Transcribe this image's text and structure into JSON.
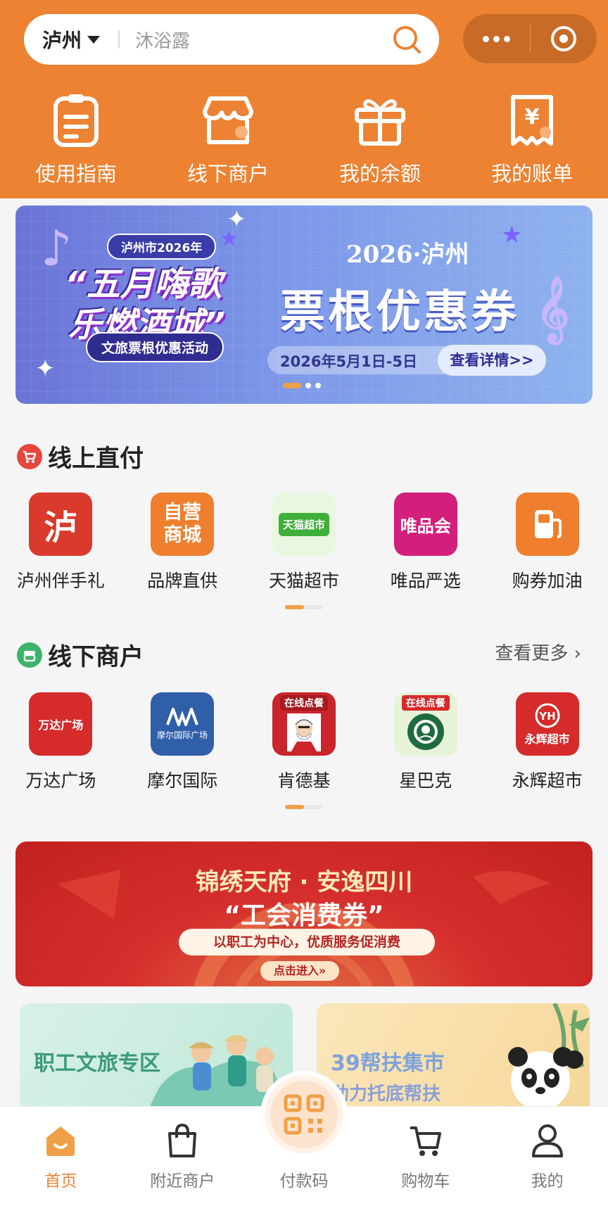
{
  "header": {
    "city": "泸州",
    "search_placeholder": "沐浴露",
    "bg_color": "#ec8232"
  },
  "capsule": {
    "more": "more-icon",
    "close": "target-icon"
  },
  "top_nav": [
    {
      "label": "使用指南",
      "icon": "guide-icon"
    },
    {
      "label": "线下商户",
      "icon": "store-icon"
    },
    {
      "label": "我的余额",
      "icon": "gift-icon"
    },
    {
      "label": "我的账单",
      "icon": "bill-icon"
    }
  ],
  "banner": {
    "tag": "泸州市2026年",
    "headline_1": "“五月嗨歌",
    "headline_2": "乐燃酒城”",
    "subtitle": "文旅票根优惠活动",
    "year_city": "2026·泸州",
    "main_title": "票根优惠券",
    "date_range": "2026年5月1日-5日",
    "cta": "查看详情>>"
  },
  "online_section": {
    "title": "线上直付",
    "apps": [
      {
        "name": "泸州伴手礼",
        "tile_text": "泸",
        "color": "#d93a2b"
      },
      {
        "name": "品牌直供",
        "tile_text": "自营商城",
        "color": "#ef7e2e"
      },
      {
        "name": "天猫超市",
        "tile_text": "天猫超市",
        "color": "#e9f7e0"
      },
      {
        "name": "唯品严选",
        "tile_text": "唯品会",
        "color": "#d31e7b"
      },
      {
        "name": "购券加油",
        "tile_text": "",
        "color": "#ef7e2e"
      }
    ]
  },
  "offline_section": {
    "title": "线下商户",
    "more": "查看更多",
    "merchants": [
      {
        "name": "万达广场",
        "tile_text": "万达广场",
        "color": "#d52b2b"
      },
      {
        "name": "摩尔国际",
        "tile_text": "摩尔国际广场",
        "color": "#2f5fa8"
      },
      {
        "name": "肯德基",
        "tile_text": "在线点餐",
        "color": "#c9252b"
      },
      {
        "name": "星巴克",
        "tile_text": "在线点餐",
        "color": "#1e6b3f"
      },
      {
        "name": "永辉超市",
        "tile_text": "永辉超市",
        "color": "#d52b2b"
      }
    ]
  },
  "promo": {
    "line1": "锦绣天府 · 安逸四川",
    "line2": "“工会消费券”",
    "pill": "以职工为中心，优质服务促消费",
    "enter": "点击进入»"
  },
  "cards": [
    {
      "title": "职工文旅专区",
      "color": "#3a9b78"
    },
    {
      "title": "39帮扶集市",
      "subtitle": "助力托底帮扶",
      "color": "#7fa2dc"
    }
  ],
  "tabbar": [
    {
      "label": "首页",
      "icon": "home-icon",
      "active": true
    },
    {
      "label": "附近商户",
      "icon": "shopping-bag-icon"
    },
    {
      "label": "付款码",
      "icon": "qr-code-icon"
    },
    {
      "label": "购物车",
      "icon": "cart-icon"
    },
    {
      "label": "我的",
      "icon": "user-icon"
    }
  ],
  "accent_color": "#ec8232"
}
